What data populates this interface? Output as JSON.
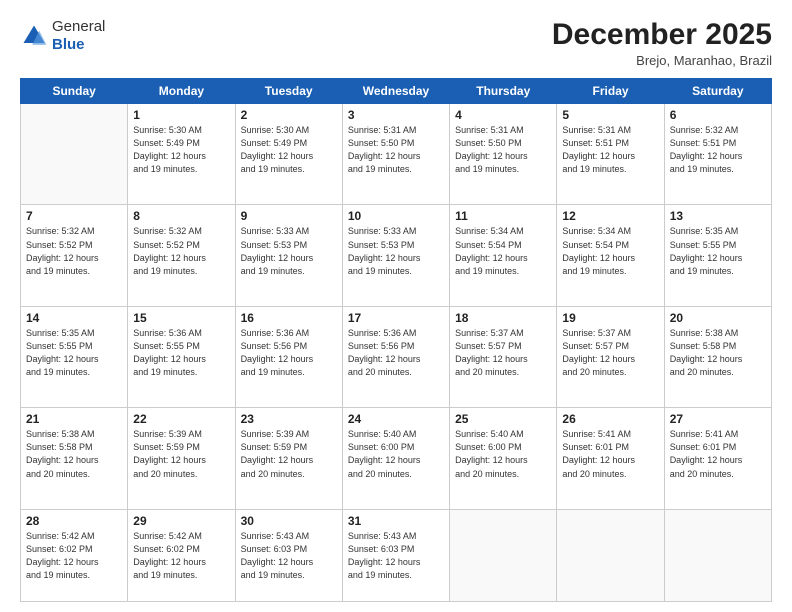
{
  "header": {
    "logo_general": "General",
    "logo_blue": "Blue",
    "month": "December 2025",
    "location": "Brejo, Maranhao, Brazil"
  },
  "days_of_week": [
    "Sunday",
    "Monday",
    "Tuesday",
    "Wednesday",
    "Thursday",
    "Friday",
    "Saturday"
  ],
  "weeks": [
    [
      {
        "day": "",
        "info": ""
      },
      {
        "day": "1",
        "info": "Sunrise: 5:30 AM\nSunset: 5:49 PM\nDaylight: 12 hours\nand 19 minutes."
      },
      {
        "day": "2",
        "info": "Sunrise: 5:30 AM\nSunset: 5:49 PM\nDaylight: 12 hours\nand 19 minutes."
      },
      {
        "day": "3",
        "info": "Sunrise: 5:31 AM\nSunset: 5:50 PM\nDaylight: 12 hours\nand 19 minutes."
      },
      {
        "day": "4",
        "info": "Sunrise: 5:31 AM\nSunset: 5:50 PM\nDaylight: 12 hours\nand 19 minutes."
      },
      {
        "day": "5",
        "info": "Sunrise: 5:31 AM\nSunset: 5:51 PM\nDaylight: 12 hours\nand 19 minutes."
      },
      {
        "day": "6",
        "info": "Sunrise: 5:32 AM\nSunset: 5:51 PM\nDaylight: 12 hours\nand 19 minutes."
      }
    ],
    [
      {
        "day": "7",
        "info": "Sunrise: 5:32 AM\nSunset: 5:52 PM\nDaylight: 12 hours\nand 19 minutes."
      },
      {
        "day": "8",
        "info": "Sunrise: 5:32 AM\nSunset: 5:52 PM\nDaylight: 12 hours\nand 19 minutes."
      },
      {
        "day": "9",
        "info": "Sunrise: 5:33 AM\nSunset: 5:53 PM\nDaylight: 12 hours\nand 19 minutes."
      },
      {
        "day": "10",
        "info": "Sunrise: 5:33 AM\nSunset: 5:53 PM\nDaylight: 12 hours\nand 19 minutes."
      },
      {
        "day": "11",
        "info": "Sunrise: 5:34 AM\nSunset: 5:54 PM\nDaylight: 12 hours\nand 19 minutes."
      },
      {
        "day": "12",
        "info": "Sunrise: 5:34 AM\nSunset: 5:54 PM\nDaylight: 12 hours\nand 19 minutes."
      },
      {
        "day": "13",
        "info": "Sunrise: 5:35 AM\nSunset: 5:55 PM\nDaylight: 12 hours\nand 19 minutes."
      }
    ],
    [
      {
        "day": "14",
        "info": "Sunrise: 5:35 AM\nSunset: 5:55 PM\nDaylight: 12 hours\nand 19 minutes."
      },
      {
        "day": "15",
        "info": "Sunrise: 5:36 AM\nSunset: 5:55 PM\nDaylight: 12 hours\nand 19 minutes."
      },
      {
        "day": "16",
        "info": "Sunrise: 5:36 AM\nSunset: 5:56 PM\nDaylight: 12 hours\nand 19 minutes."
      },
      {
        "day": "17",
        "info": "Sunrise: 5:36 AM\nSunset: 5:56 PM\nDaylight: 12 hours\nand 20 minutes."
      },
      {
        "day": "18",
        "info": "Sunrise: 5:37 AM\nSunset: 5:57 PM\nDaylight: 12 hours\nand 20 minutes."
      },
      {
        "day": "19",
        "info": "Sunrise: 5:37 AM\nSunset: 5:57 PM\nDaylight: 12 hours\nand 20 minutes."
      },
      {
        "day": "20",
        "info": "Sunrise: 5:38 AM\nSunset: 5:58 PM\nDaylight: 12 hours\nand 20 minutes."
      }
    ],
    [
      {
        "day": "21",
        "info": "Sunrise: 5:38 AM\nSunset: 5:58 PM\nDaylight: 12 hours\nand 20 minutes."
      },
      {
        "day": "22",
        "info": "Sunrise: 5:39 AM\nSunset: 5:59 PM\nDaylight: 12 hours\nand 20 minutes."
      },
      {
        "day": "23",
        "info": "Sunrise: 5:39 AM\nSunset: 5:59 PM\nDaylight: 12 hours\nand 20 minutes."
      },
      {
        "day": "24",
        "info": "Sunrise: 5:40 AM\nSunset: 6:00 PM\nDaylight: 12 hours\nand 20 minutes."
      },
      {
        "day": "25",
        "info": "Sunrise: 5:40 AM\nSunset: 6:00 PM\nDaylight: 12 hours\nand 20 minutes."
      },
      {
        "day": "26",
        "info": "Sunrise: 5:41 AM\nSunset: 6:01 PM\nDaylight: 12 hours\nand 20 minutes."
      },
      {
        "day": "27",
        "info": "Sunrise: 5:41 AM\nSunset: 6:01 PM\nDaylight: 12 hours\nand 20 minutes."
      }
    ],
    [
      {
        "day": "28",
        "info": "Sunrise: 5:42 AM\nSunset: 6:02 PM\nDaylight: 12 hours\nand 19 minutes."
      },
      {
        "day": "29",
        "info": "Sunrise: 5:42 AM\nSunset: 6:02 PM\nDaylight: 12 hours\nand 19 minutes."
      },
      {
        "day": "30",
        "info": "Sunrise: 5:43 AM\nSunset: 6:03 PM\nDaylight: 12 hours\nand 19 minutes."
      },
      {
        "day": "31",
        "info": "Sunrise: 5:43 AM\nSunset: 6:03 PM\nDaylight: 12 hours\nand 19 minutes."
      },
      {
        "day": "",
        "info": ""
      },
      {
        "day": "",
        "info": ""
      },
      {
        "day": "",
        "info": ""
      }
    ]
  ]
}
